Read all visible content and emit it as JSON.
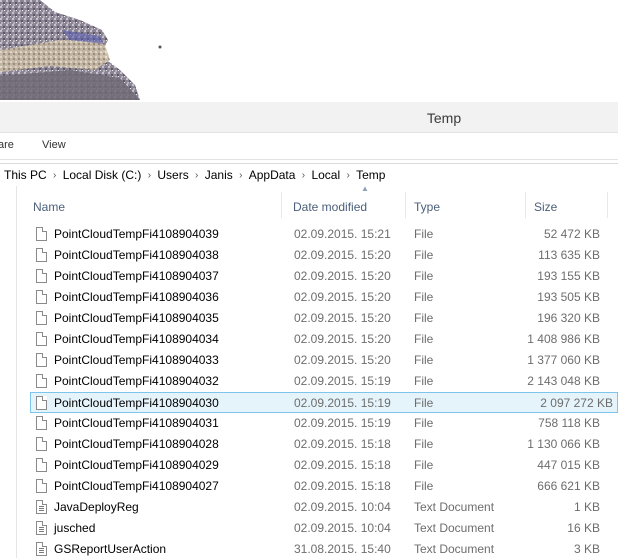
{
  "window": {
    "title": "Temp"
  },
  "ribbon": {
    "tabs": [
      {
        "label": "are"
      },
      {
        "label": "View"
      }
    ]
  },
  "address": {
    "crumbs": [
      "This PC",
      "Local Disk (C:)",
      "Users",
      "Janis",
      "AppData",
      "Local",
      "Temp"
    ],
    "separator_icon": "chevron-right-icon"
  },
  "columns": {
    "name": "Name",
    "date": "Date modified",
    "type": "Type",
    "size": "Size"
  },
  "files": [
    {
      "name": "PointCloudTempFi4108904039",
      "date": "02.09.2015. 15:21",
      "type": "File",
      "size": "52 472 KB",
      "icon": "file-icon"
    },
    {
      "name": "PointCloudTempFi4108904038",
      "date": "02.09.2015. 15:20",
      "type": "File",
      "size": "113 635 KB",
      "icon": "file-icon"
    },
    {
      "name": "PointCloudTempFi4108904037",
      "date": "02.09.2015. 15:20",
      "type": "File",
      "size": "193 155 KB",
      "icon": "file-icon"
    },
    {
      "name": "PointCloudTempFi4108904036",
      "date": "02.09.2015. 15:20",
      "type": "File",
      "size": "193 505 KB",
      "icon": "file-icon"
    },
    {
      "name": "PointCloudTempFi4108904035",
      "date": "02.09.2015. 15:20",
      "type": "File",
      "size": "196 320 KB",
      "icon": "file-icon"
    },
    {
      "name": "PointCloudTempFi4108904034",
      "date": "02.09.2015. 15:20",
      "type": "File",
      "size": "1 408 986 KB",
      "icon": "file-icon"
    },
    {
      "name": "PointCloudTempFi4108904033",
      "date": "02.09.2015. 15:20",
      "type": "File",
      "size": "1 377 060 KB",
      "icon": "file-icon"
    },
    {
      "name": "PointCloudTempFi4108904032",
      "date": "02.09.2015. 15:19",
      "type": "File",
      "size": "2 143 048 KB",
      "icon": "file-icon"
    },
    {
      "name": "PointCloudTempFi4108904030",
      "date": "02.09.2015. 15:19",
      "type": "File",
      "size": "2 097 272 KB",
      "icon": "file-icon",
      "selected": true
    },
    {
      "name": "PointCloudTempFi4108904031",
      "date": "02.09.2015. 15:19",
      "type": "File",
      "size": "758 118 KB",
      "icon": "file-icon"
    },
    {
      "name": "PointCloudTempFi4108904028",
      "date": "02.09.2015. 15:18",
      "type": "File",
      "size": "1 130 066 KB",
      "icon": "file-icon"
    },
    {
      "name": "PointCloudTempFi4108904029",
      "date": "02.09.2015. 15:18",
      "type": "File",
      "size": "447 015 KB",
      "icon": "file-icon"
    },
    {
      "name": "PointCloudTempFi4108904027",
      "date": "02.09.2015. 15:18",
      "type": "File",
      "size": "666 621 KB",
      "icon": "file-icon"
    },
    {
      "name": "JavaDeployReg",
      "date": "02.09.2015. 10:04",
      "type": "Text Document",
      "size": "1 KB",
      "icon": "text-document-icon"
    },
    {
      "name": "jusched",
      "date": "02.09.2015. 10:04",
      "type": "Text Document",
      "size": "16 KB",
      "icon": "text-document-icon"
    },
    {
      "name": "GSReportUserAction",
      "date": "31.08.2015. 15:40",
      "type": "Text Document",
      "size": "3 KB",
      "icon": "text-document-icon"
    }
  ],
  "colors": {
    "selection_bg": "#e5f3fb",
    "selection_border": "#7fc4ea",
    "header_text": "#4c607a"
  }
}
